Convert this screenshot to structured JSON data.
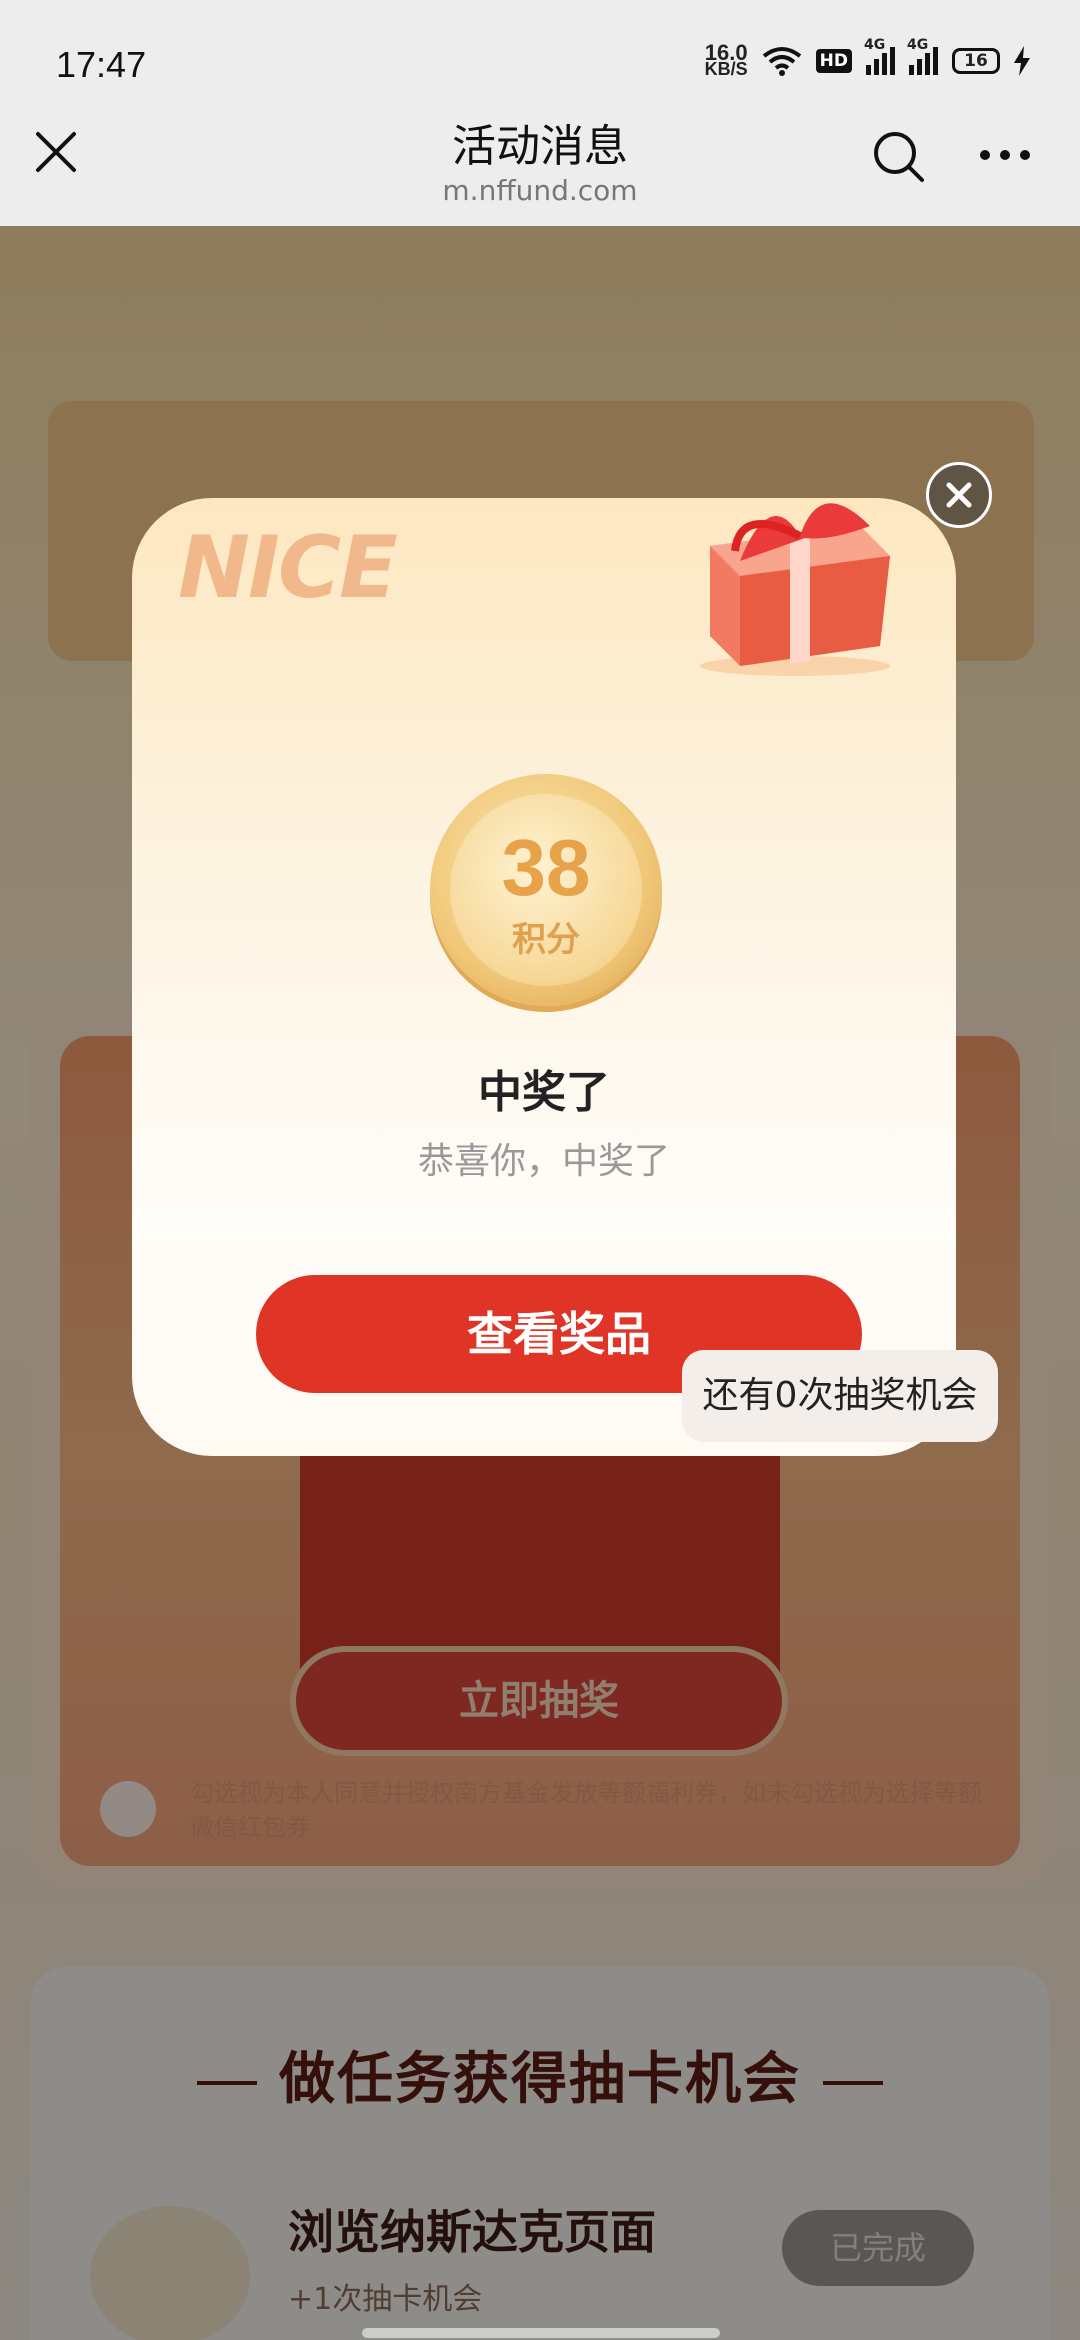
{
  "status_bar": {
    "time": "17:47",
    "net_speed_value": "16.0",
    "net_speed_unit": "KB/S",
    "hd_badge": "HD",
    "signal_1_label": "4G",
    "signal_2_label": "4G",
    "battery_level": "16"
  },
  "nav": {
    "title": "活动消息",
    "domain": "m.nffund.com"
  },
  "background": {
    "draw_button": "立即抽奖",
    "chances_text": "还有0次抽奖机会",
    "consent_text": "勾选视为本人同意并授权南方基金发放等额福利券，如未勾选视为选择等额微信红包券",
    "task_section_title": "做任务获得抽卡机会",
    "task_name": "浏览纳斯达克页面",
    "task_reward": "+1次抽卡机会",
    "task_status_button": "已完成"
  },
  "modal": {
    "decor_text": "NICE",
    "coin_value": "38",
    "coin_unit": "积分",
    "title": "中奖了",
    "subtitle": "恭喜你，中奖了",
    "primary_button": "查看奖品"
  },
  "colors": {
    "primary_red": "#e03526",
    "coin_gold": "#e7a24a",
    "overlay": "rgba(0,0,0,0.42)"
  }
}
